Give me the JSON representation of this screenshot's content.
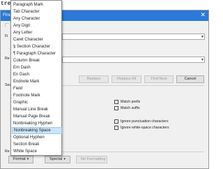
{
  "doc": {
    "text": "tres"
  },
  "dialog": {
    "title": "Find",
    "find_label": "Fi",
    "replace_label": "Re",
    "search_label": "Sea",
    "replace_with_label": "Re",
    "buttons": {
      "replace": "Replace",
      "replace_all": "Replace All",
      "find_next": "Find Next",
      "cancel": "Cancel"
    },
    "options": [
      {
        "label": "Match prefix",
        "checked": false
      },
      {
        "label": "Match suffix",
        "checked": false
      },
      {
        "label": "Ignore punctuation characters",
        "checked": false
      },
      {
        "label": "Ignore white-space characters",
        "checked": false
      }
    ],
    "bottom": {
      "format": "Format",
      "special": "Special",
      "no_formatting": "No Formatting"
    }
  },
  "menu": {
    "items": [
      "Paragraph Mark",
      "Tab Character",
      "Any Character",
      "Any Digit",
      "Any Letter",
      "Caret Character",
      "§ Section Character",
      "¶ Paragraph Character",
      "Column Break",
      "Em Dash",
      "En Dash",
      "Endnote Mark",
      "Field",
      "Footnote Mark",
      "Graphic",
      "Manual Line Break",
      "Manual Page Break",
      "Nonbreaking Hyphen",
      "Nonbreaking Space",
      "Optional Hyphen",
      "Section Break",
      "White Space"
    ],
    "highlighted_index": 18
  },
  "colors": {
    "titlebar": "#2b79d8",
    "highlight": "#cce4f7"
  }
}
